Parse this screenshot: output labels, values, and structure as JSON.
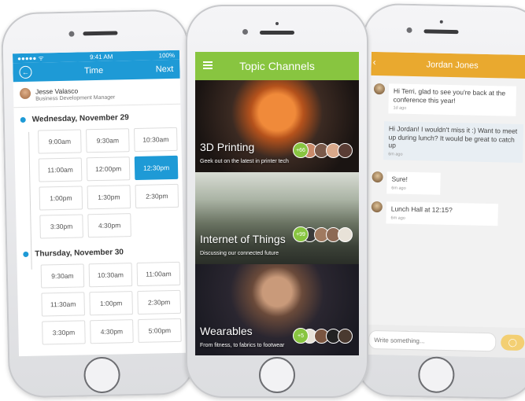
{
  "phone1": {
    "status": {
      "signal": "●●●●● ᯤ",
      "time": "9:41 AM",
      "battery": "100%"
    },
    "nav": {
      "back_icon": "back-circle-icon",
      "title": "Time",
      "next": "Next"
    },
    "profile": {
      "name": "Jesse Valasco",
      "role": "Business Development Manager"
    },
    "days": [
      {
        "label": "Wednesday, November 29",
        "slots": [
          "9:00am",
          "9:30am",
          "10:30am",
          "11:00am",
          "12:00pm",
          "12:30pm",
          "1:00pm",
          "1:30pm",
          "2:30pm",
          "3:30pm",
          "4:30pm"
        ],
        "selected": "12:30pm"
      },
      {
        "label": "Thursday, November 30",
        "slots": [
          "9:30am",
          "10:30am",
          "11:00am",
          "11:30am",
          "1:00pm",
          "2:30pm",
          "3:30pm",
          "4:30pm",
          "5:00pm"
        ],
        "selected": ""
      }
    ],
    "accent": "#1e9ad6"
  },
  "phone2": {
    "nav": {
      "menu_icon": "hamburger-menu-icon",
      "title": "Topic Channels"
    },
    "channels": [
      {
        "title": "3D Printing",
        "subtitle": "Geek out on the latest in printer tech",
        "count": "+66"
      },
      {
        "title": "Internet of Things",
        "subtitle": "Discussing our connected future",
        "count": "+99"
      },
      {
        "title": "Wearables",
        "subtitle": "From fitness, to fabrics to footwear",
        "count": "+5"
      }
    ],
    "accent": "#88c540"
  },
  "phone3": {
    "nav": {
      "title": "Jordan Jones"
    },
    "messages": [
      {
        "text": "Hi Terri, glad to see you're back at the conference this year!",
        "time": "1d ago",
        "side": "left"
      },
      {
        "text": "Hi Jordan! I wouldn't miss it :) Want to meet up during lunch? It would be great to catch up",
        "time": "6m ago",
        "side": "right"
      },
      {
        "text": "Sure!",
        "time": "6m ago",
        "side": "left"
      },
      {
        "text": "Lunch Hall at 12:15?",
        "time": "6m ago",
        "side": "left"
      }
    ],
    "composer": {
      "placeholder": "Write something..."
    },
    "accent": "#e9a92f"
  }
}
